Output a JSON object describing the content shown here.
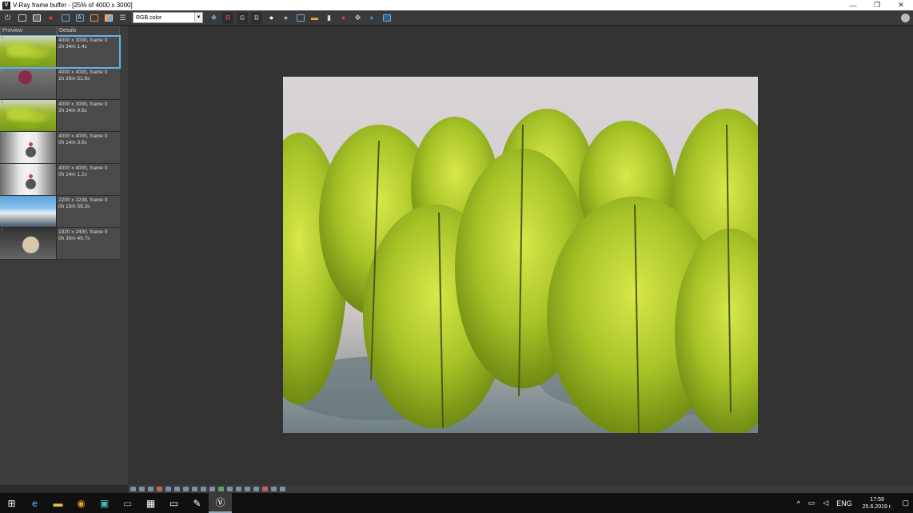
{
  "window": {
    "app_icon": "V",
    "title": "V-Ray frame buffer - [25% of 4000 x 3000]",
    "minimize": "—",
    "maximize": "❐",
    "close": "✕"
  },
  "toolbar": {
    "channel_select": "RGB color",
    "channel_r": "R",
    "channel_g": "G",
    "channel_b": "B"
  },
  "history": {
    "col_preview": "Preview",
    "col_details": "Details",
    "items": [
      {
        "num": "1",
        "line1": "4000 x 3000, frame 0",
        "line2": "2h 34m 1.4s"
      },
      {
        "num": "2",
        "line1": "4000 x 4000, frame 0",
        "line2": "1h 26m 51.6s"
      },
      {
        "num": "3",
        "line1": "4000 x 3000, frame 0",
        "line2": "2h 34m 9.6s"
      },
      {
        "num": "4",
        "line1": "4000 x 4000, frame 0",
        "line2": "0h 14m 3.6s"
      },
      {
        "num": "5",
        "line1": "4000 x 4000, frame 0",
        "line2": "0h 14m 1.2s"
      },
      {
        "num": "6",
        "line1": "2200 x 1238, frame 0",
        "line2": "0h 15m 59.3s"
      },
      {
        "num": "7",
        "line1": "1920 x 2400, frame 0",
        "line2": "0h 30m 49.7s"
      }
    ]
  },
  "taskbar": {
    "lang": "ENG",
    "time": "17:59",
    "date": "25.6.2019 г."
  }
}
